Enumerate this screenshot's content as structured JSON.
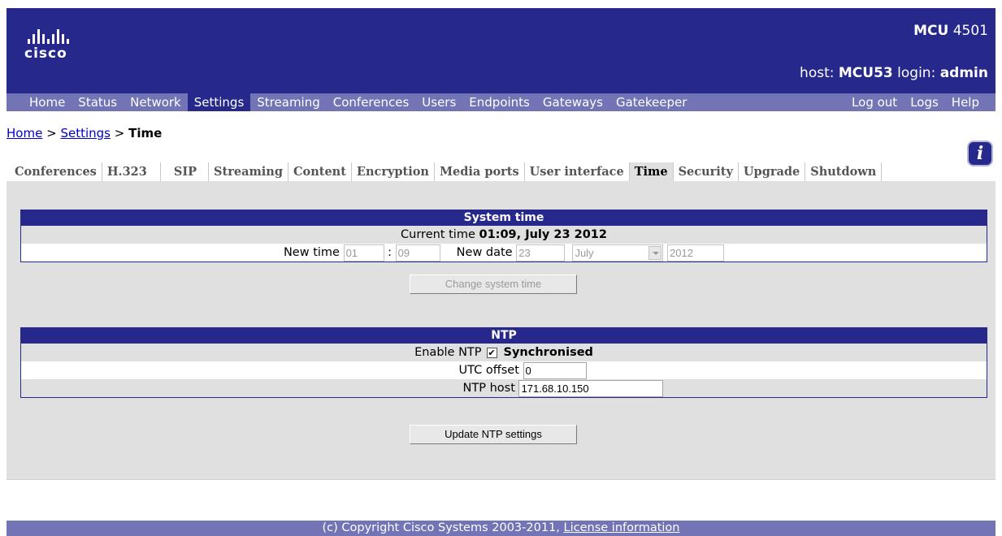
{
  "header": {
    "logo_text": "cisco",
    "product_bold": "MCU",
    "product_model": "4501",
    "host_label": "host:",
    "host_value": "MCU53",
    "login_label": "login:",
    "login_value": "admin"
  },
  "nav": {
    "items": [
      "Home",
      "Status",
      "Network",
      "Settings",
      "Streaming",
      "Conferences",
      "Users",
      "Endpoints",
      "Gateways",
      "Gatekeeper"
    ],
    "right_items": [
      "Log out",
      "Logs",
      "Help"
    ],
    "active": "Settings"
  },
  "breadcrumb": {
    "home": "Home",
    "sep1": ">",
    "settings": "Settings",
    "sep2": ">",
    "current": "Time"
  },
  "tabs": {
    "items": [
      "Conferences",
      "H.323",
      "SIP",
      "Streaming",
      "Content",
      "Encryption",
      "Media ports",
      "User interface",
      "Time",
      "Security",
      "Upgrade",
      "Shutdown"
    ],
    "active": "Time"
  },
  "system_time": {
    "title": "System time",
    "current_label": "Current time",
    "current_value": "01:09, July 23 2012",
    "new_time_label": "New time",
    "hour": "01",
    "colon": ":",
    "minute": "09",
    "new_date_label": "New date",
    "day": "23",
    "month": "July",
    "year": "2012",
    "button": "Change system time"
  },
  "ntp": {
    "title": "NTP",
    "enable_label": "Enable NTP",
    "enable_checked": "✔",
    "status": "Synchronised",
    "utc_label": "UTC offset",
    "utc_value": "0",
    "host_label": "NTP host",
    "host_value": "171.68.10.150",
    "button": "Update NTP settings"
  },
  "footer": {
    "copyright": "(c) Copyright Cisco Systems 2003-2011,",
    "license_link": "License information"
  },
  "colors": {
    "header_bg": "#27288c",
    "nav_bg": "#7274b6",
    "panel_bg": "#e0e0e0"
  }
}
